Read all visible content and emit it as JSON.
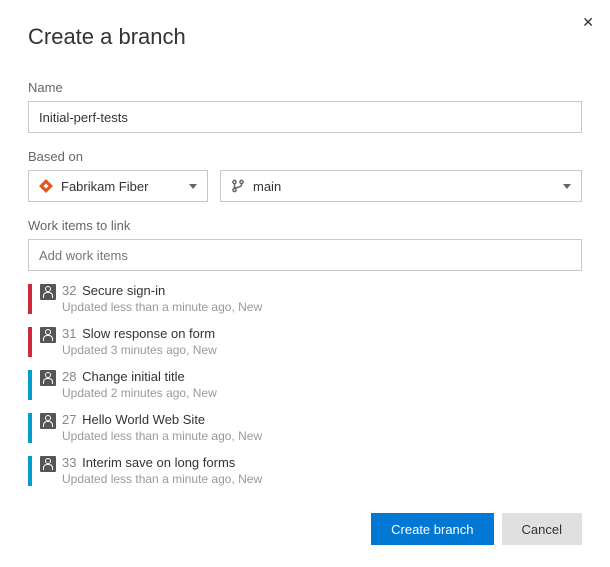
{
  "dialog": {
    "title": "Create a branch",
    "name_label": "Name",
    "name_value": "Initial-perf-tests",
    "based_on_label": "Based on",
    "repo": {
      "label": "Fabrikam Fiber"
    },
    "branch": {
      "label": "main"
    },
    "work_items_label": "Work items to link",
    "work_items_placeholder": "Add work items",
    "work_items": [
      {
        "color": "red",
        "id": "32",
        "title": "Secure sign-in",
        "meta": "Updated less than a minute ago, New"
      },
      {
        "color": "red",
        "id": "31",
        "title": "Slow response on form",
        "meta": "Updated 3 minutes ago, New"
      },
      {
        "color": "blue",
        "id": "28",
        "title": "Change initial title",
        "meta": "Updated 2 minutes ago, New"
      },
      {
        "color": "blue",
        "id": "27",
        "title": "Hello World Web Site",
        "meta": "Updated less than a minute ago, New"
      },
      {
        "color": "blue",
        "id": "33",
        "title": "Interim save on long forms",
        "meta": "Updated less than a minute ago, New"
      }
    ],
    "buttons": {
      "primary": "Create branch",
      "secondary": "Cancel"
    }
  }
}
